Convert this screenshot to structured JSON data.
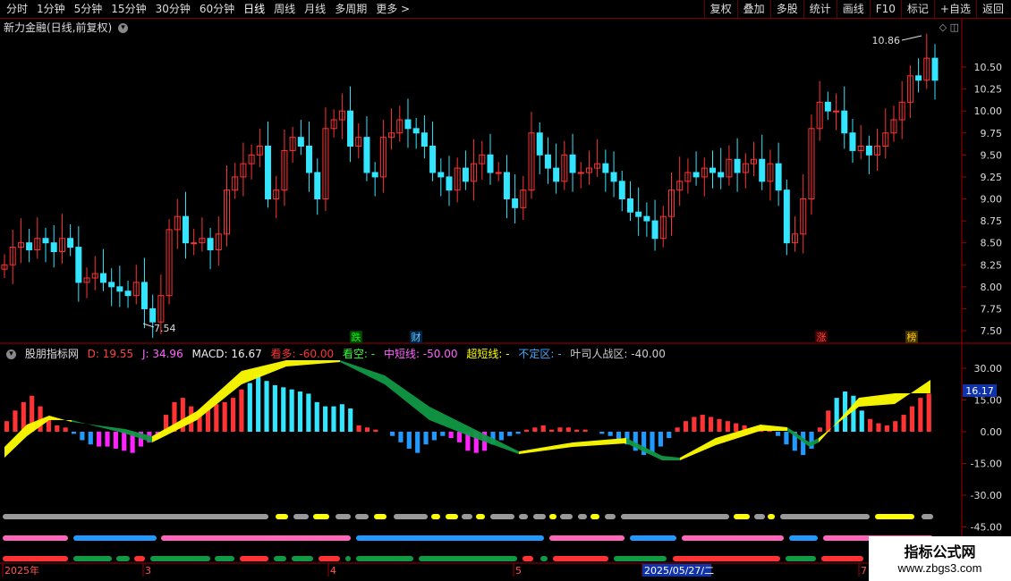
{
  "toolbar": {
    "periods": [
      "分时",
      "1分钟",
      "5分钟",
      "15分钟",
      "30分钟",
      "60分钟",
      "日线",
      "周线",
      "月线",
      "多周期",
      "更多 >"
    ],
    "active_period": "日线",
    "tools": [
      "复权",
      "叠加",
      "多股",
      "统计",
      "画线",
      "F10",
      "标记",
      "+自选",
      "返回"
    ]
  },
  "stock": {
    "title": "新力金融(日线,前复权)"
  },
  "price_panel": {
    "high_label": "10.86",
    "low_label": "7.54",
    "y_ticks": [
      "10.50",
      "10.25",
      "10.00",
      "9.75",
      "9.50",
      "9.25",
      "9.00",
      "8.75",
      "8.50",
      "8.25",
      "8.00",
      "7.75",
      "7.50"
    ],
    "markers": [
      {
        "text": "跌",
        "color": "#00ff00",
        "bg": "#004400"
      },
      {
        "text": "财",
        "color": "#66ccff",
        "bg": "#002244"
      },
      {
        "text": "涨",
        "color": "#ff4444",
        "bg": "#440000"
      },
      {
        "text": "榜",
        "color": "#ffcc00",
        "bg": "#443300"
      }
    ]
  },
  "indicator": {
    "name": "股朋指标网",
    "d": "D: 19.55",
    "j": "J: 34.96",
    "macd": "MACD: 16.67",
    "bull": "看多: -60.00",
    "bear": "看空: -",
    "mid": "中短线: -50.00",
    "super": "超短线: -",
    "zone": "不定区: -",
    "ye": "叶司人战区: -40.00",
    "y_ticks": [
      "30.00",
      "15.00",
      "0.00",
      "-15.00",
      "-30.00",
      "-45.00"
    ],
    "current_value": "16.17"
  },
  "date_axis": {
    "labels": [
      "2025年",
      "3",
      "4",
      "5",
      "2025/05/27/二",
      "7"
    ]
  },
  "watermark": {
    "line1": "指标公式网",
    "line2": "www.zbgs3.com"
  },
  "colors": {
    "up": "#ff3333",
    "down": "#33e5ff",
    "yellow": "#ffff00",
    "green": "#119944",
    "magenta": "#ff22ff",
    "pink": "#ff66bb",
    "blue": "#2299ff",
    "grey": "#999999"
  }
}
